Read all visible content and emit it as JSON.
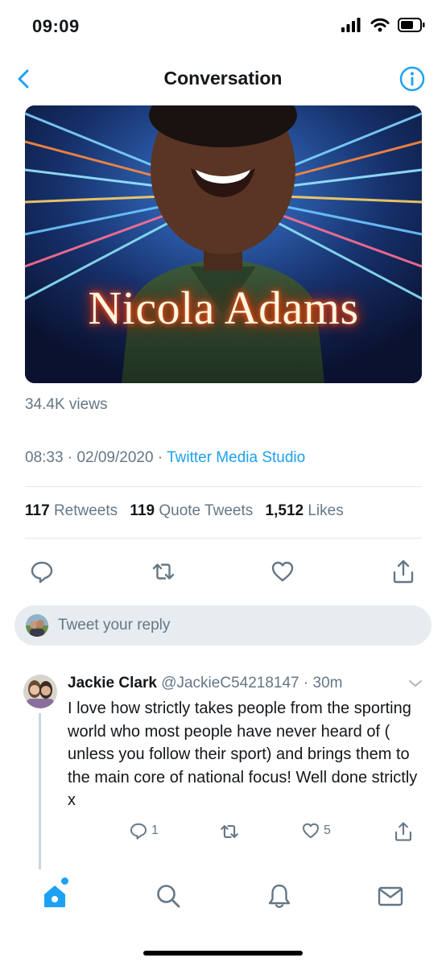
{
  "status_bar": {
    "time": "09:09"
  },
  "nav": {
    "title": "Conversation"
  },
  "media": {
    "title_text": "Nicola Adams"
  },
  "tweet": {
    "views": "34.4K views",
    "time": "08:33",
    "date": "02/09/2020",
    "source": "Twitter Media Studio",
    "retweets_count": "117",
    "retweets_label": "Retweets",
    "quote_tweets_count": "119",
    "quote_tweets_label": "Quote Tweets",
    "likes_count": "1,512",
    "likes_label": "Likes"
  },
  "reply_box": {
    "placeholder": "Tweet your reply"
  },
  "reply": {
    "name": "Jackie Clark",
    "handle": "@JackieC54218147",
    "time": "30m",
    "text": "I love how strictly takes people from the sporting world who most people have never heard of ( unless you follow their sport) and brings them to the main core of national focus! Well done strictly x",
    "reply_count": "1",
    "like_count": "5"
  },
  "icons": {
    "back": "chevron-left-icon",
    "info": "info-icon",
    "reply": "reply-icon",
    "retweet": "retweet-icon",
    "like": "heart-icon",
    "share": "share-icon",
    "home": "home-icon",
    "search": "search-icon",
    "notifications": "bell-icon",
    "messages": "mail-icon"
  },
  "colors": {
    "accent": "#1da1f2",
    "secondary_text": "#657786",
    "primary_text": "#14171a",
    "reply_box_bg": "#e6ecf0"
  }
}
